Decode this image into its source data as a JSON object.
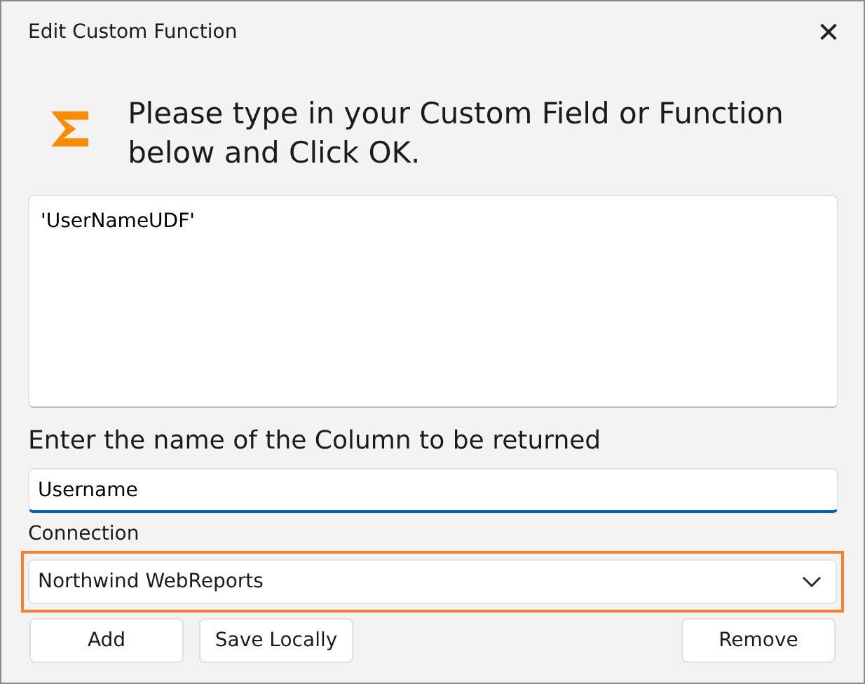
{
  "window": {
    "title": "Edit Custom Function",
    "close": "✕"
  },
  "header": {
    "text": "Please type in your Custom Field or Function below and Click OK."
  },
  "function_text": {
    "value": "'UserNameUDF'"
  },
  "column_label": "Enter the name of the Column to be returned",
  "column_field": {
    "value": "Username",
    "focused": true
  },
  "connection": {
    "label": "Connection",
    "value": "Northwind WebReports",
    "highlighted": true
  },
  "left_buttons": [
    "Add",
    "Save Locally"
  ],
  "right_buttons": [
    "Remove"
  ]
}
